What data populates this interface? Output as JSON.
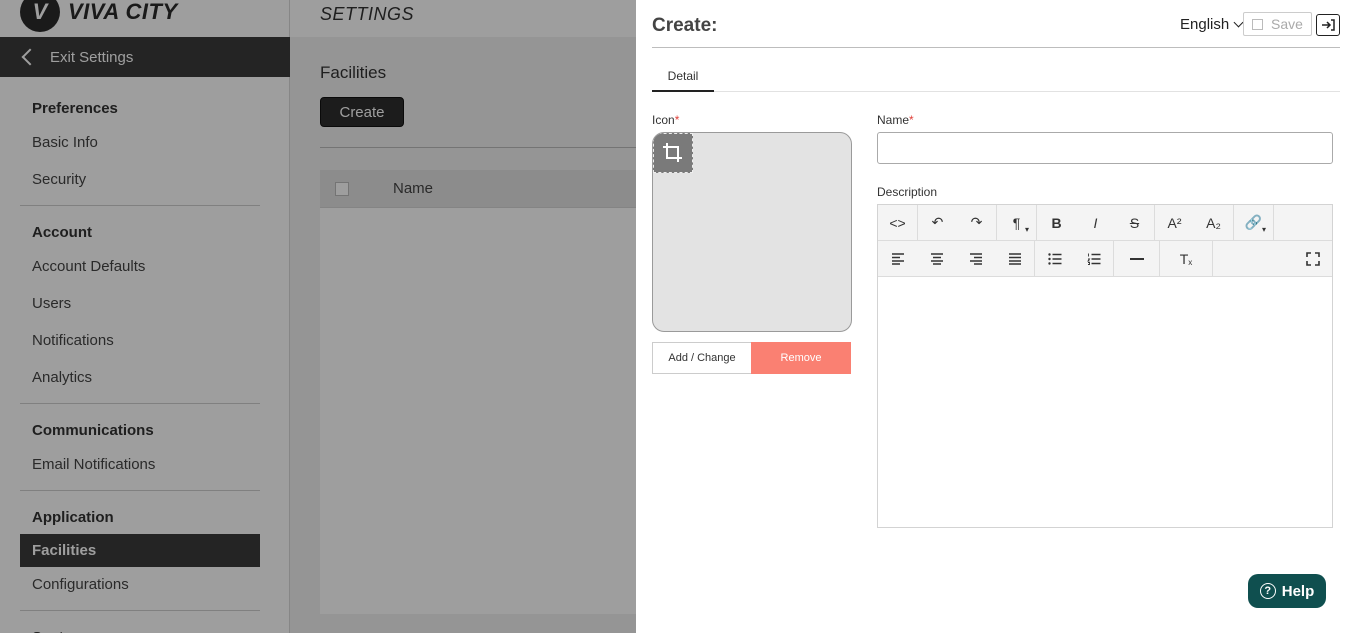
{
  "brand": {
    "logo_letter": "V",
    "name": "VIVA CITY"
  },
  "header": {
    "title": "SETTINGS"
  },
  "sidebar": {
    "exit_label": "Exit Settings",
    "sections": [
      {
        "title": "Preferences",
        "items": [
          "Basic Info",
          "Security"
        ]
      },
      {
        "title": "Account",
        "items": [
          "Account Defaults",
          "Users",
          "Notifications",
          "Analytics"
        ]
      },
      {
        "title": "Communications",
        "items": [
          "Email Notifications"
        ]
      },
      {
        "title": "Application",
        "items": [
          "Facilities",
          "Configurations"
        ]
      },
      {
        "title": "System",
        "items": []
      }
    ],
    "active_item": "Facilities"
  },
  "main": {
    "title": "Facilities",
    "create_label": "Create",
    "table": {
      "columns": [
        "Name"
      ]
    }
  },
  "panel": {
    "title": "Create:",
    "language": "English",
    "save_label": "Save",
    "tabs": [
      "Detail"
    ],
    "icon_label": "Icon",
    "required_mark": "*",
    "add_change_label": "Add / Change",
    "remove_label": "Remove",
    "name_label": "Name",
    "name_value": "",
    "description_label": "Description",
    "help_label": "Help"
  },
  "editor": {
    "toolbar_row1": [
      [
        "code-icon"
      ],
      [
        "undo-icon",
        "redo-icon"
      ],
      [
        "paragraph-icon"
      ],
      [
        "bold-icon",
        "italic-icon",
        "strikethrough-icon"
      ],
      [
        "superscript-icon",
        "subscript-icon"
      ],
      [
        "link-icon"
      ]
    ],
    "toolbar_row2": [
      [
        "align-left-icon",
        "align-center-icon",
        "align-right-icon",
        "align-justify-icon"
      ],
      [
        "bullet-list-icon",
        "numbered-list-icon"
      ],
      [
        "horizontal-rule-icon"
      ],
      [
        "clear-format-icon"
      ]
    ]
  },
  "colors": {
    "accent_dark": "#3a3a3a",
    "remove": "#fa8072",
    "help": "#0f4f4f",
    "required": "#e0403a"
  }
}
